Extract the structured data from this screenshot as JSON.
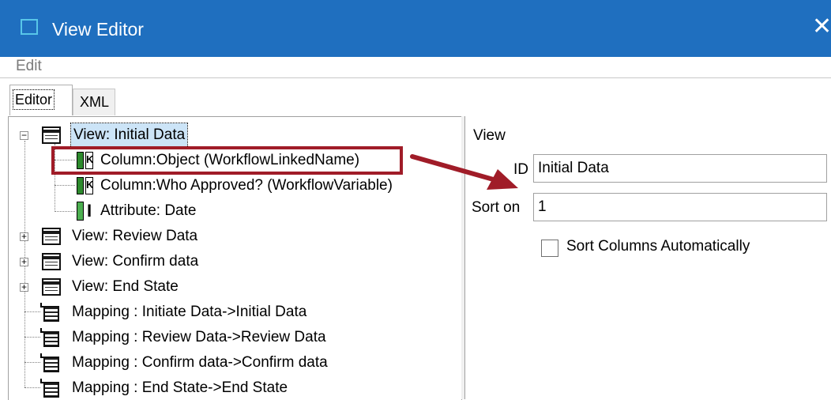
{
  "window": {
    "title": "View Editor",
    "close_glyph": "✕",
    "accent": "#1f6fbf"
  },
  "menu": {
    "edit": "Edit"
  },
  "tabs": {
    "editor": "Editor",
    "xml": "XML"
  },
  "tree": {
    "view_initial": "View: Initial Data",
    "col_object": "Column:Object (WorkflowLinkedName)",
    "col_who": "Column:Who Approved? (WorkflowVariable)",
    "attr_date": "Attribute: Date",
    "view_review": "View: Review Data",
    "view_confirm": "View: Confirm data",
    "view_end": "View: End State",
    "map_initiate": "Mapping : Initiate Data->Initial Data",
    "map_review": "Mapping : Review Data->Review Data",
    "map_confirm": "Mapping : Confirm data->Confirm data",
    "map_end": "Mapping : End State->End State"
  },
  "properties": {
    "section_title": "View",
    "id_label": "ID",
    "id_value": "Initial Data",
    "sort_label": "Sort on",
    "sort_value": "1",
    "sort_auto_label": "Sort Columns Automatically",
    "sort_auto_checked": false
  },
  "annotation": {
    "color": "#a01c28"
  }
}
